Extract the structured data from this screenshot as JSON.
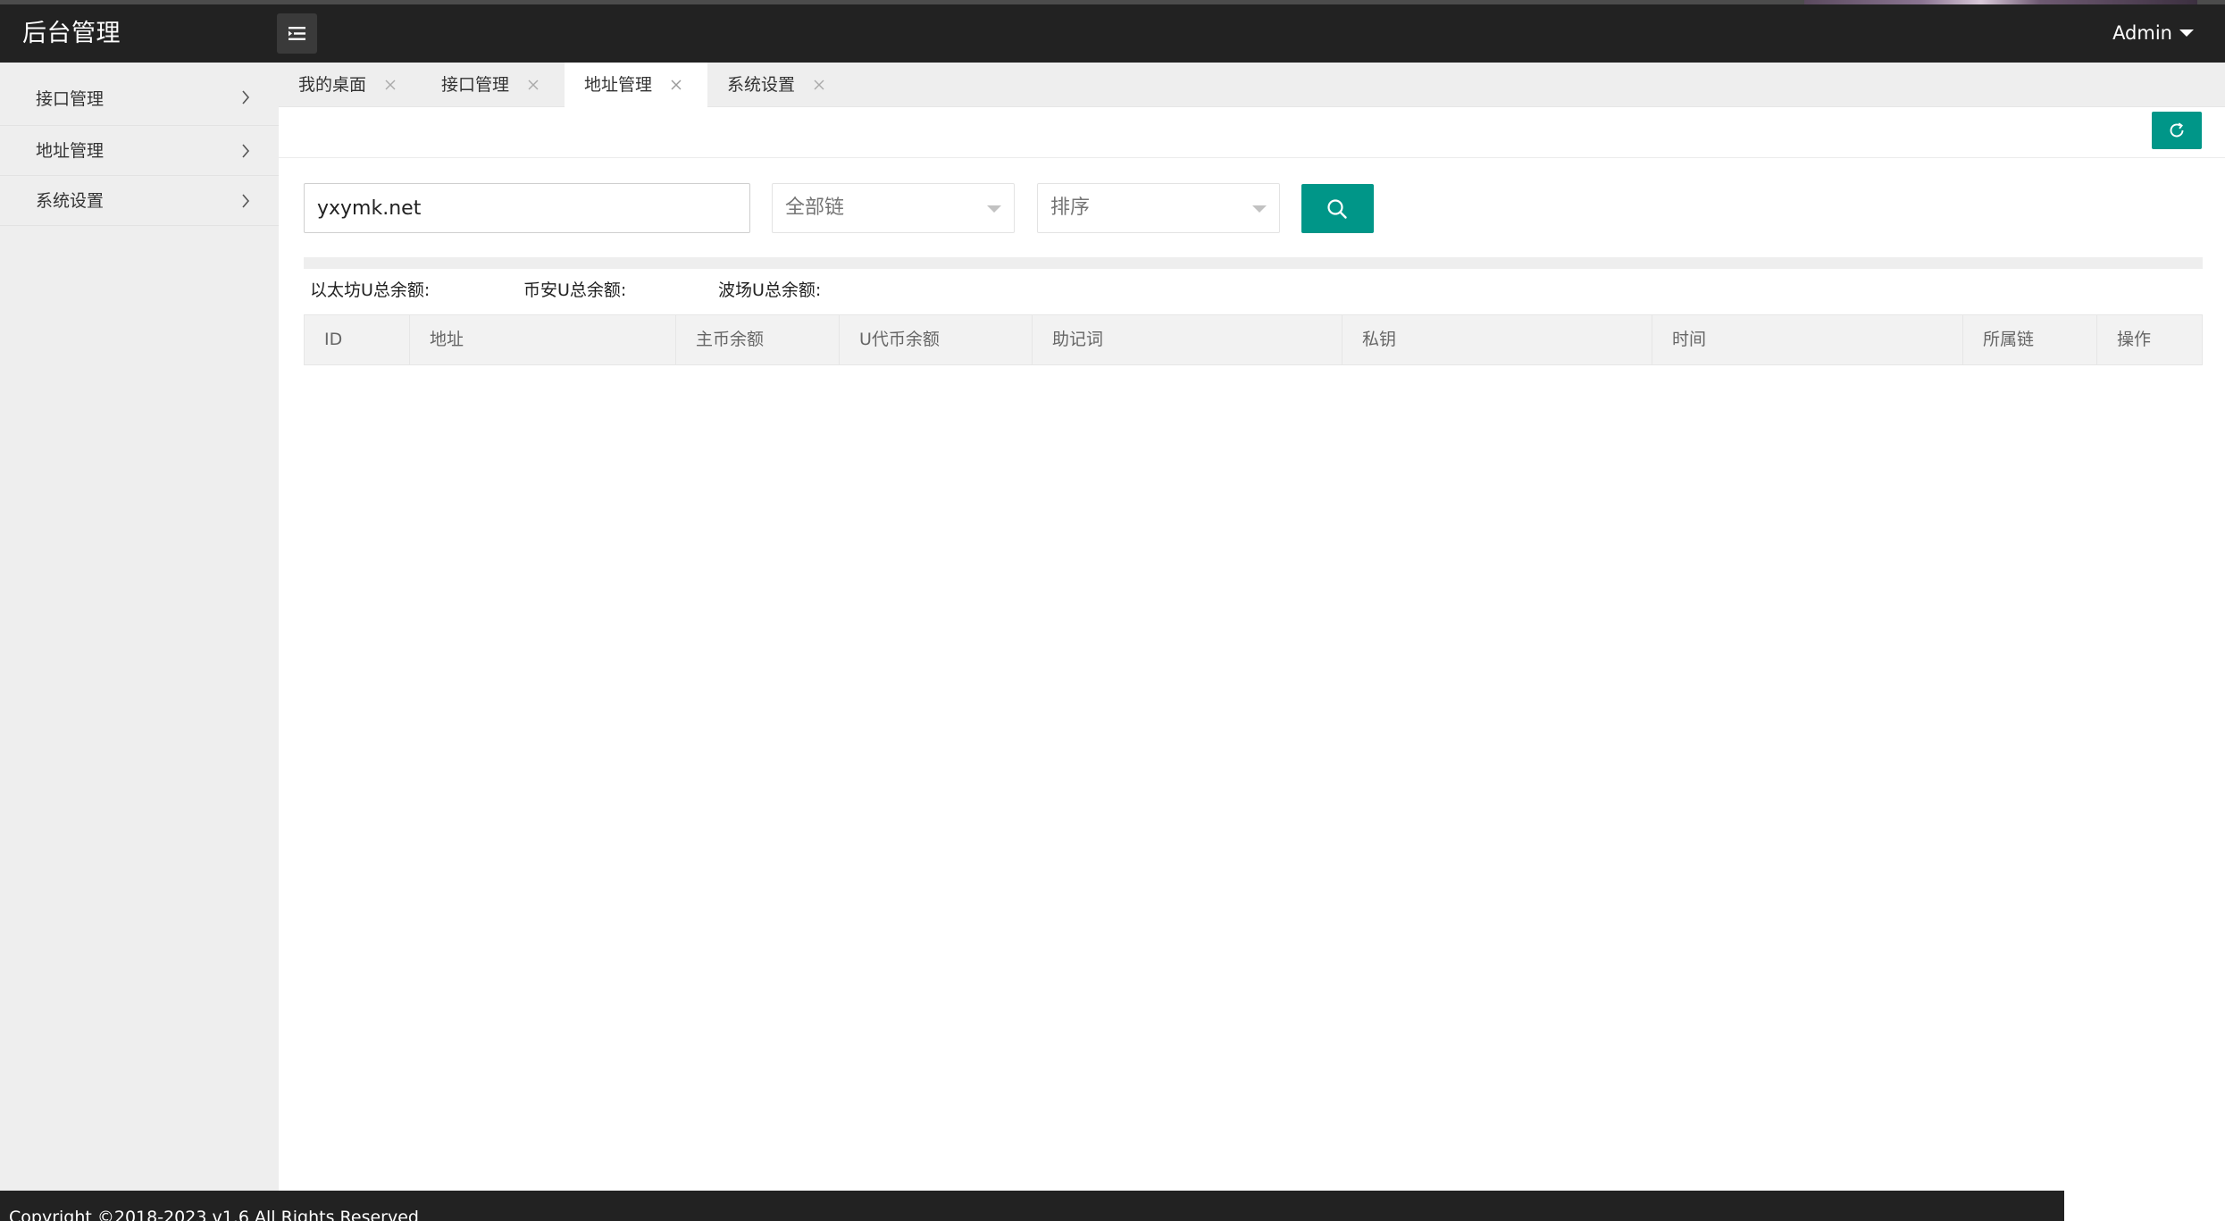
{
  "header": {
    "brand": "后台管理",
    "user": "Admin"
  },
  "sidebar": {
    "items": [
      {
        "label": "接口管理"
      },
      {
        "label": "地址管理"
      },
      {
        "label": "系统设置"
      }
    ]
  },
  "tabs": [
    {
      "label": "我的桌面",
      "active": false
    },
    {
      "label": "接口管理",
      "active": false
    },
    {
      "label": "地址管理",
      "active": true
    },
    {
      "label": "系统设置",
      "active": false
    }
  ],
  "search": {
    "keyword_value": "yxymk.net",
    "chain_select": "全部链",
    "sort_select": "排序"
  },
  "totals": {
    "eth_label": "以太坊U总余额:",
    "bsc_label": "币安U总余额:",
    "tron_label": "波场U总余额:"
  },
  "table": {
    "columns": [
      "ID",
      "地址",
      "主币余额",
      "U代币余额",
      "助记词",
      "私钥",
      "时间",
      "所属链",
      "操作"
    ],
    "rows": []
  },
  "footer": {
    "copyright": "Copyright ©2018-2023 v1.6 All Rights Reserved"
  },
  "colors": {
    "header_bg": "#222222",
    "accent": "#009688",
    "sidebar_bg": "#eeeeee"
  },
  "icons": {
    "menu_toggle": "menu-fold-icon",
    "user_caret": "caret-down-icon",
    "refresh": "refresh-icon",
    "search": "search-icon",
    "sidebar_chevron": "chevron-right-icon",
    "tab_close": "close-icon"
  }
}
